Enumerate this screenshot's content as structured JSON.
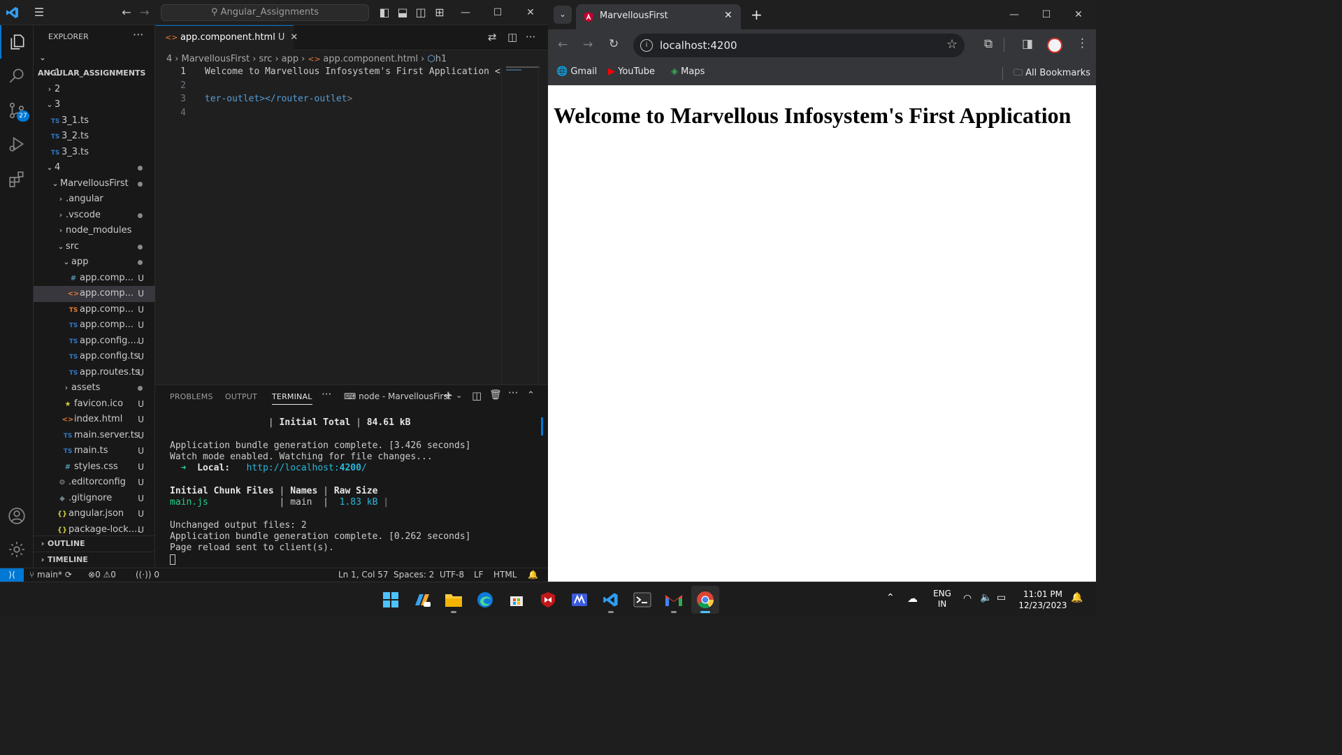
{
  "vscode": {
    "title_search": "Angular_Assignments",
    "explorer_title": "EXPLORER",
    "workspace": "ANGULAR_ASSIGNMENTS",
    "scm_badge": "27",
    "tree": [
      {
        "label": "1",
        "status": ""
      },
      {
        "label": "2",
        "status": ""
      },
      {
        "label": "3",
        "status": ""
      },
      {
        "label": "3_1.ts",
        "status": ""
      },
      {
        "label": "3_2.ts",
        "status": ""
      },
      {
        "label": "3_3.ts",
        "status": ""
      },
      {
        "label": "4",
        "status": ""
      },
      {
        "label": "MarvellousFirst",
        "status": ""
      },
      {
        "label": ".angular",
        "status": ""
      },
      {
        "label": ".vscode",
        "status": ""
      },
      {
        "label": "node_modules",
        "status": ""
      },
      {
        "label": "src",
        "status": ""
      },
      {
        "label": "app",
        "status": ""
      },
      {
        "label": "app.comp...",
        "status": "U"
      },
      {
        "label": "app.comp...",
        "status": "U"
      },
      {
        "label": "app.comp...",
        "status": "U"
      },
      {
        "label": "app.comp...",
        "status": "U"
      },
      {
        "label": "app.config....",
        "status": "U"
      },
      {
        "label": "app.config.ts",
        "status": "U"
      },
      {
        "label": "app.routes.ts",
        "status": "U"
      },
      {
        "label": "assets",
        "status": ""
      },
      {
        "label": "favicon.ico",
        "status": "U"
      },
      {
        "label": "index.html",
        "status": "U"
      },
      {
        "label": "main.server.ts",
        "status": "U"
      },
      {
        "label": "main.ts",
        "status": "U"
      },
      {
        "label": "styles.css",
        "status": "U"
      },
      {
        "label": ".editorconfig",
        "status": "U"
      },
      {
        "label": ".gitignore",
        "status": "U"
      },
      {
        "label": "angular.json",
        "status": "U"
      },
      {
        "label": "package-lock....",
        "status": "U"
      }
    ],
    "outline": "OUTLINE",
    "timeline": "TIMELINE",
    "tab": {
      "label": "app.component.html",
      "modified": "U"
    },
    "breadcrumb": [
      "4",
      "MarvellousFirst",
      "src",
      "app",
      "app.component.html",
      "h1"
    ],
    "code_lines": [
      {
        "num": "1",
        "text": "Welcome to Marvellous Infosystem's First Application <"
      },
      {
        "num": "2",
        "text": ""
      },
      {
        "num": "3",
        "text_plain": "ter-outlet></",
        "text_tag": "router-outlet",
        "text_end": ">"
      },
      {
        "num": "4",
        "text": ""
      }
    ],
    "panel_tabs": {
      "problems": "PROBLEMS",
      "output": "OUTPUT",
      "terminal": "TERMINAL"
    },
    "terminal_name": "node - MarvellousFirst",
    "terminal": {
      "l1a": "                  | ",
      "l1b": "Initial Total",
      "l1c": " | ",
      "l1d": "84.61 kB",
      "l3": "Application bundle generation complete. [3.426 seconds]",
      "l4": "Watch mode enabled. Watching for file changes...",
      "l5_arrow": "  ➜ ",
      "l5_label": " Local:",
      "l5_pre": "   http://localhost:",
      "l5_port": "4200",
      "l5_post": "/",
      "l7a": "Initial Chunk Files",
      "l7b": " | ",
      "l7c": "Names",
      "l7d": " | ",
      "l7e": "Raw Size",
      "l8a": "main.js",
      "l8b": "             | main  | ",
      "l8c": " 1.83 kB",
      "l8d": " |",
      "l10": "Unchanged output files: 2",
      "l11": "Application bundle generation complete. [0.262 seconds]",
      "l12": "Page reload sent to client(s)."
    },
    "status": {
      "branch": "main*",
      "errors": "0",
      "warnings": "0",
      "ports": "0",
      "position": "Ln 1, Col 57",
      "spaces": "Spaces: 2",
      "encoding": "UTF-8",
      "eol": "LF",
      "language": "HTML"
    }
  },
  "chrome": {
    "tab_title": "MarvellousFirst",
    "url": "localhost:4200",
    "bookmarks": [
      "Gmail",
      "YouTube",
      "Maps"
    ],
    "all_bookmarks": "All Bookmarks",
    "heading": "Welcome to Marvellous Infosystem's First Application"
  },
  "taskbar": {
    "lang1": "ENG",
    "lang2": "IN",
    "time": "11:01 PM",
    "date": "12/23/2023"
  },
  "colors": {
    "vscode_accent": "#0078d4",
    "chrome_frame": "#1f1f1f"
  }
}
